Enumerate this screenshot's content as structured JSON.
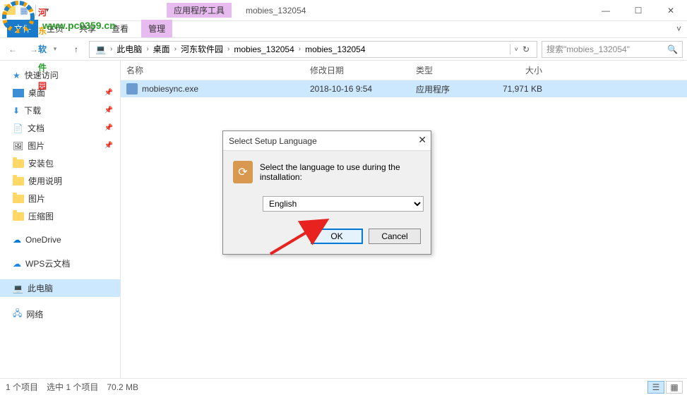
{
  "titlebar": {
    "contextual_tab": "应用程序工具",
    "window_title": "mobies_132054"
  },
  "ribbon": {
    "file": "文件",
    "home": "主页",
    "share": "共享",
    "view": "查看",
    "manage": "管理"
  },
  "address": {
    "segments": [
      "此电脑",
      "桌面",
      "河东软件园",
      "mobies_132054",
      "mobies_132054"
    ],
    "search_placeholder": "搜索\"mobies_132054\""
  },
  "columns": {
    "name": "名称",
    "date": "修改日期",
    "type": "类型",
    "size": "大小"
  },
  "files": [
    {
      "name": "mobiesync.exe",
      "date": "2018-10-16 9:54",
      "type": "应用程序",
      "size": "71,971 KB"
    }
  ],
  "sidebar": {
    "quick_access": "快速访问",
    "desktop": "桌面",
    "downloads": "下载",
    "documents": "文档",
    "pictures": "图片",
    "install": "安装包",
    "instructions": "使用说明",
    "pictures2": "图片",
    "compressed": "压缩图",
    "onedrive": "OneDrive",
    "wps": "WPS云文档",
    "thispc": "此电脑",
    "network": "网络"
  },
  "status": {
    "count": "1 个项目",
    "selected": "选中 1 个项目",
    "size": "70.2 MB"
  },
  "dialog": {
    "title": "Select Setup Language",
    "message": "Select the language to use during the installation:",
    "selected": "English",
    "ok": "OK",
    "cancel": "Cancel"
  },
  "watermark": {
    "text": "河东软件园",
    "url": "www.pc0359.cn"
  }
}
